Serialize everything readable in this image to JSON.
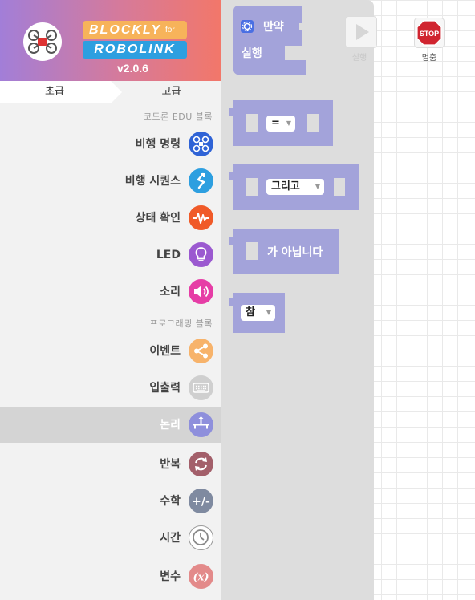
{
  "header": {
    "brand_top": "BLOCKLY",
    "brand_for": "for",
    "brand_bottom": "ROBOLINK",
    "version": "v2.0.6"
  },
  "tabs": {
    "basic": "초급",
    "advanced": "고급"
  },
  "sections": {
    "coderone": "코드론 EDU 블록",
    "programming": "프로그래밍 블록"
  },
  "categories": [
    {
      "label": "비행 명령",
      "icon": "drone-icon",
      "color": "#2f63d6"
    },
    {
      "label": "비행 시퀀스",
      "icon": "sequence-icon",
      "color": "#2d9fe0"
    },
    {
      "label": "상태 확인",
      "icon": "pulse-icon",
      "color": "#f05a28"
    },
    {
      "label": "LED",
      "icon": "bulb-icon",
      "color": "#9b59d0"
    },
    {
      "label": "소리",
      "icon": "speaker-icon",
      "color": "#e63da6"
    },
    {
      "label": "이벤트",
      "icon": "share-icon",
      "color": "#f7b36b"
    },
    {
      "label": "입출력",
      "icon": "keyboard-icon",
      "color": "#cfcfcf"
    },
    {
      "label": "논리",
      "icon": "logic-icon",
      "color": "#8e8fdc",
      "selected": true
    },
    {
      "label": "반복",
      "icon": "loop-icon",
      "color": "#a35f6a"
    },
    {
      "label": "수학",
      "icon": "plus-minus-icon",
      "color": "#7f8aa0"
    },
    {
      "label": "시간",
      "icon": "clock-icon",
      "color": "#ffffff"
    },
    {
      "label": "변수",
      "icon": "variable-icon",
      "color": "#e38a8a"
    }
  ],
  "flyout": {
    "if_block": {
      "if_text": "만약",
      "do_text": "실행"
    },
    "compare_block": {
      "operator": "="
    },
    "and_block": {
      "operator": "그리고"
    },
    "not_block": {
      "text": "가 아닙니다"
    },
    "bool_block": {
      "value": "참"
    }
  },
  "controls": {
    "run_label": "실행",
    "stop_label": "멈춤",
    "stop_sign": "STOP"
  },
  "colors": {
    "logic_block": "#a3a3da",
    "stop": "#d0242f"
  }
}
